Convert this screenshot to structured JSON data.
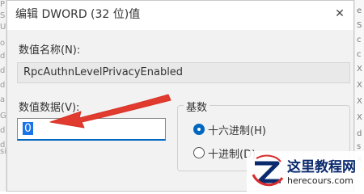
{
  "dialog": {
    "title": "编辑 DWORD (32 位)值",
    "close_glyph": "✕"
  },
  "value_name": {
    "label": "数值名称(N):",
    "value": "RpcAuthnLevelPrivacyEnabled"
  },
  "value_data": {
    "label": "数值数据(V):",
    "value": "0"
  },
  "base": {
    "label": "基数",
    "options": [
      {
        "label": "十六进制(H)",
        "selected": true
      },
      {
        "label": "十进制(D)",
        "selected": false
      }
    ]
  },
  "watermark": {
    "title": "这里教程网",
    "url": "herecours.com"
  },
  "annotation": {
    "arrow_color": "#e03b2e",
    "shape": "red-arrow"
  },
  "background_fragments": {
    "left": [
      "P",
      "S",
      "U",
      "o",
      "d",
      "d",
      "d",
      "a",
      "G",
      "d",
      "d",
      "si"
    ],
    "right": [
      "e",
      "S",
      "c",
      "c",
      "X",
      "X",
      "X",
      "X",
      "d",
      "s",
      "X"
    ]
  }
}
